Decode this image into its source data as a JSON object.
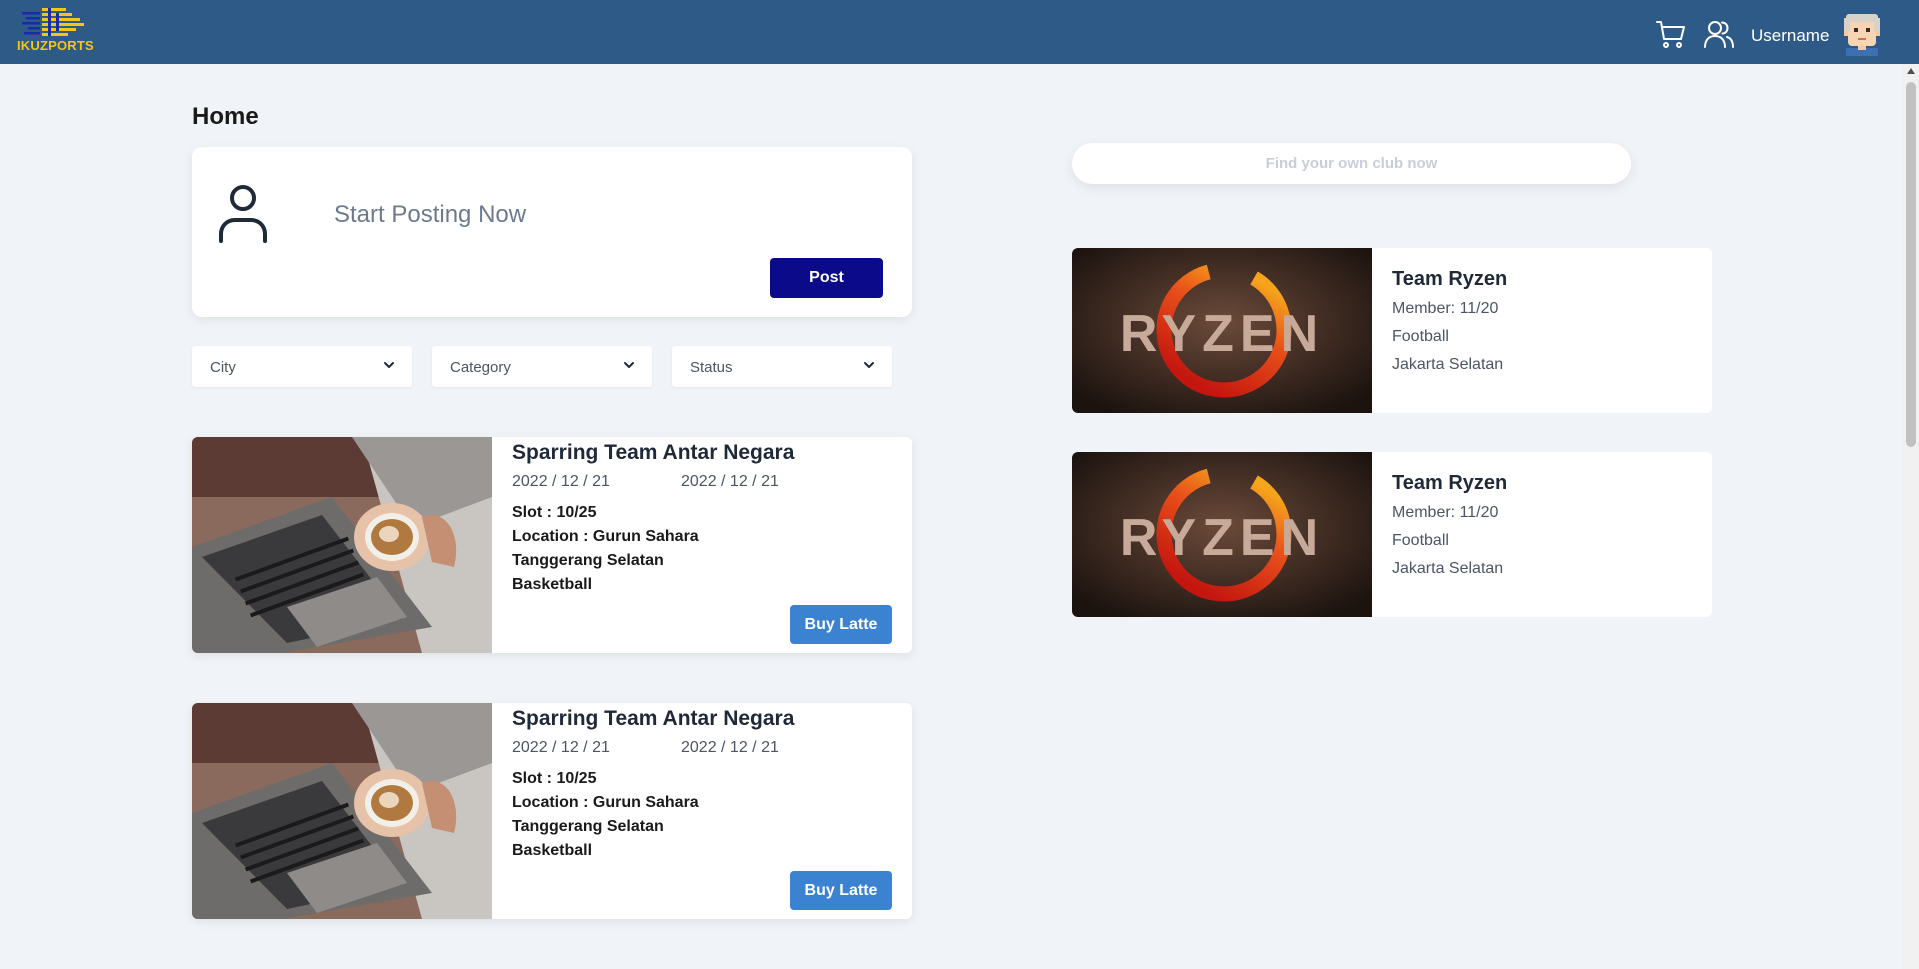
{
  "header": {
    "logo_text": "IKUZPORTS",
    "username": "Username",
    "icons": [
      "cart-icon",
      "people-icon"
    ],
    "bg_color": "#2e5a88",
    "logo_color": "#f5c518"
  },
  "page": {
    "title": "Home"
  },
  "post_box": {
    "placeholder": "Start Posting Now",
    "button_label": "Post"
  },
  "filters": [
    {
      "label": "City"
    },
    {
      "label": "Category"
    },
    {
      "label": "Status"
    }
  ],
  "events": [
    {
      "title": "Sparring Team Antar Negara",
      "date_start": "2022 / 12 / 21",
      "date_end": "2022 / 12 / 21",
      "slot": "Slot : 10/25",
      "location": "Location : Gurun Sahara",
      "city": "Tanggerang Selatan",
      "sport": "Basketball",
      "button_label": "Buy Latte"
    },
    {
      "title": "Sparring Team Antar Negara",
      "date_start": "2022 / 12 / 21",
      "date_end": "2022 / 12 / 21",
      "slot": "Slot : 10/25",
      "location": "Location : Gurun Sahara",
      "city": "Tanggerang Selatan",
      "sport": "Basketball",
      "button_label": "Buy Latte"
    }
  ],
  "search": {
    "placeholder": "Find your own club now"
  },
  "clubs": [
    {
      "image_text": "RYZEN",
      "name": "Team Ryzen",
      "members": "Member: 11/20",
      "sport": "Football",
      "city": "Jakarta Selatan"
    },
    {
      "image_text": "RYZEN",
      "name": "Team Ryzen",
      "members": "Member: 11/20",
      "sport": "Football",
      "city": "Jakarta Selatan"
    }
  ],
  "colors": {
    "post_button": "#0a0a8a",
    "buy_button": "#3b82d0",
    "page_bg": "#f0f4f8"
  }
}
